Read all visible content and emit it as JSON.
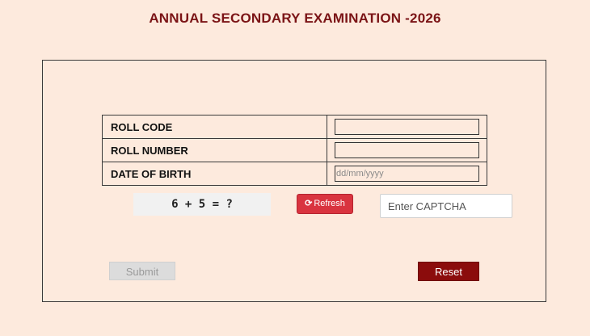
{
  "header": {
    "title": "ANNUAL SECONDARY EXAMINATION -2026"
  },
  "form": {
    "fields": [
      {
        "label": "ROLL CODE",
        "value": "",
        "placeholder": ""
      },
      {
        "label": "ROLL NUMBER",
        "value": "",
        "placeholder": ""
      },
      {
        "label": "DATE OF BIRTH",
        "value": "",
        "placeholder": "dd/mm/yyyy"
      }
    ]
  },
  "captcha": {
    "question": "6 + 5 = ?",
    "refresh_icon": "refresh-icon",
    "refresh_glyph": "⟳",
    "refresh_label": "Refresh",
    "input_placeholder": "Enter CAPTCHA",
    "input_value": ""
  },
  "actions": {
    "submit_label": "Submit",
    "reset_label": "Reset"
  },
  "colors": {
    "page_background": "#fdeadd",
    "title": "#7b1416",
    "refresh_button": "#d9343f",
    "reset_button": "#8b0c0c",
    "submit_disabled": "#dcdcdc"
  }
}
